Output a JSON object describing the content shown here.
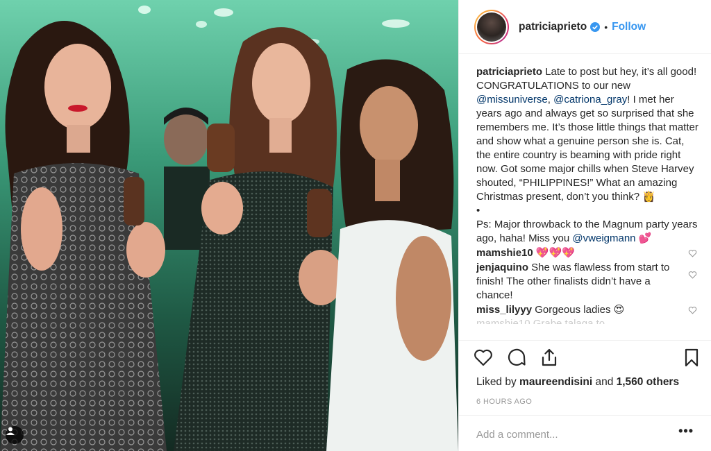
{
  "post": {
    "username": "patriciaprieto",
    "follow_label": "Follow",
    "separator": "•"
  },
  "caption": {
    "username": "patriciaprieto",
    "text_1": " Late to post but hey, it’s all good! CONGRATULATIONS to our new ",
    "mention_1": "@missuniverse",
    "text_2": ", ",
    "mention_2": "@catriona_gray",
    "text_3": "! I met her years ago and always get so surprised that she remembers me. It’s those little things that matter and show what a genuine person she is. Cat, the entire country is beaming with pride right now. Got some major chills when Steve Harvey shouted, “PHILIPPINES!” What an amazing Christmas present, don’t you think? 👸",
    "bullet": "•",
    "text_4": "Ps: Major throwback to the Magnum party years ago, haha! Miss you ",
    "mention_3": "@vweigmann",
    "text_5": " 💕"
  },
  "comments": [
    {
      "username": "mamshie10",
      "text": " 💖💖💖"
    },
    {
      "username": "jenjaquino",
      "text": " She was flawless from start to finish! The other finalists didn’t have a chance!"
    },
    {
      "username": "miss_lilyyy",
      "text": " Gorgeous ladies 😍"
    }
  ],
  "faded_comment": "mamshie10 Grabe talaga to",
  "likes": {
    "prefix": "Liked by ",
    "liked_by": "maureendisini",
    "middle": " and ",
    "others": "1,560 others"
  },
  "timestamp": "6 HOURS AGO",
  "add_comment": {
    "placeholder": "Add a comment..."
  },
  "more_label": "•••",
  "icons": {
    "like": "heart-icon",
    "comment": "comment-bubble-icon",
    "share": "share-icon",
    "save": "bookmark-icon",
    "verified": "verified-badge-icon",
    "user_tag": "user-tag-icon"
  },
  "colors": {
    "link_blue": "#3897f0",
    "mention_blue": "#003569",
    "muted": "#999999"
  }
}
